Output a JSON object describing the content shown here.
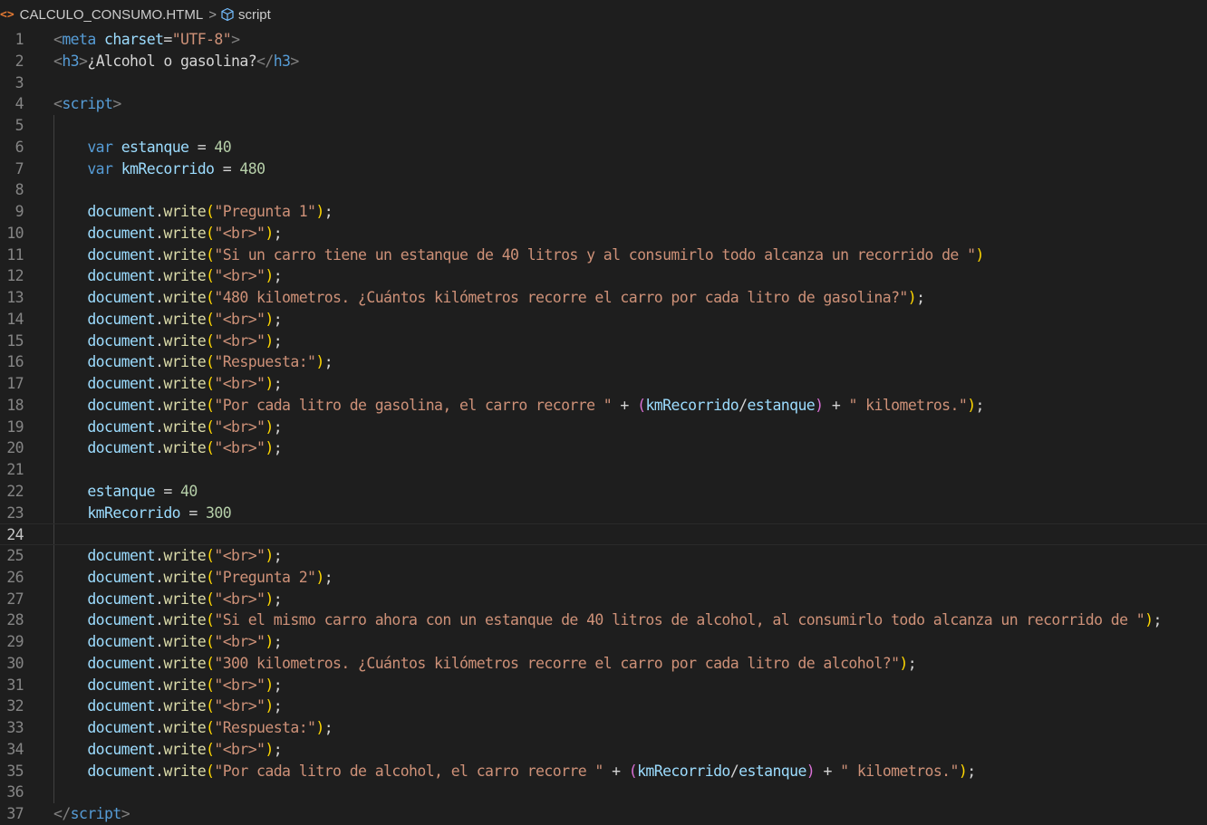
{
  "breadcrumb": {
    "file_icon": "<>",
    "file_name": "CALCULO_CONSUMO.HTML",
    "separator": ">",
    "symbol_icon": "cube-icon",
    "symbol": "script"
  },
  "editor": {
    "current_line": 24,
    "lines": [
      {
        "n": "1",
        "t": [
          [
            "  ",
            "p"
          ],
          [
            "<",
            "tag"
          ],
          [
            "meta",
            "tn"
          ],
          [
            " ",
            "p"
          ],
          [
            "charset",
            "attr"
          ],
          [
            "=",
            "p"
          ],
          [
            "\"UTF-8\"",
            "str"
          ],
          [
            ">",
            "tag"
          ]
        ]
      },
      {
        "n": "2",
        "t": [
          [
            "  ",
            "p"
          ],
          [
            "<",
            "tag"
          ],
          [
            "h3",
            "tn"
          ],
          [
            ">",
            "tag"
          ],
          [
            "¿Alcohol o gasolina?",
            "p"
          ],
          [
            "</",
            "tag"
          ],
          [
            "h3",
            "tn"
          ],
          [
            ">",
            "tag"
          ]
        ]
      },
      {
        "n": "3",
        "t": []
      },
      {
        "n": "4",
        "t": [
          [
            "  ",
            "p"
          ],
          [
            "<",
            "tag"
          ],
          [
            "script",
            "tn"
          ],
          [
            ">",
            "tag"
          ]
        ]
      },
      {
        "n": "5",
        "t": []
      },
      {
        "n": "6",
        "t": [
          [
            "      ",
            "p"
          ],
          [
            "var",
            "kw"
          ],
          [
            " ",
            "p"
          ],
          [
            "estanque",
            "var"
          ],
          [
            " = ",
            "p"
          ],
          [
            "40",
            "num"
          ]
        ]
      },
      {
        "n": "7",
        "t": [
          [
            "      ",
            "p"
          ],
          [
            "var",
            "kw"
          ],
          [
            " ",
            "p"
          ],
          [
            "kmRecorrido",
            "var"
          ],
          [
            " = ",
            "p"
          ],
          [
            "480",
            "num"
          ]
        ]
      },
      {
        "n": "8",
        "t": []
      },
      {
        "n": "9",
        "t": [
          [
            "      ",
            "p"
          ],
          [
            "document",
            "var"
          ],
          [
            ".",
            "p"
          ],
          [
            "write",
            "fn"
          ],
          [
            "(",
            "b1"
          ],
          [
            "\"Pregunta 1\"",
            "str"
          ],
          [
            ")",
            "b1"
          ],
          [
            ";",
            "p"
          ]
        ]
      },
      {
        "n": "10",
        "t": [
          [
            "      ",
            "p"
          ],
          [
            "document",
            "var"
          ],
          [
            ".",
            "p"
          ],
          [
            "write",
            "fn"
          ],
          [
            "(",
            "b1"
          ],
          [
            "\"<br>\"",
            "str"
          ],
          [
            ")",
            "b1"
          ],
          [
            ";",
            "p"
          ]
        ]
      },
      {
        "n": "11",
        "t": [
          [
            "      ",
            "p"
          ],
          [
            "document",
            "var"
          ],
          [
            ".",
            "p"
          ],
          [
            "write",
            "fn"
          ],
          [
            "(",
            "b1"
          ],
          [
            "\"Si un carro tiene un estanque de 40 litros y al consumirlo todo alcanza un recorrido de \"",
            "str"
          ],
          [
            ")",
            "b1"
          ]
        ]
      },
      {
        "n": "12",
        "t": [
          [
            "      ",
            "p"
          ],
          [
            "document",
            "var"
          ],
          [
            ".",
            "p"
          ],
          [
            "write",
            "fn"
          ],
          [
            "(",
            "b1"
          ],
          [
            "\"<br>\"",
            "str"
          ],
          [
            ")",
            "b1"
          ],
          [
            ";",
            "p"
          ]
        ]
      },
      {
        "n": "13",
        "t": [
          [
            "      ",
            "p"
          ],
          [
            "document",
            "var"
          ],
          [
            ".",
            "p"
          ],
          [
            "write",
            "fn"
          ],
          [
            "(",
            "b1"
          ],
          [
            "\"480 kilometros. ¿Cuántos kilómetros recorre el carro por cada litro de gasolina?\"",
            "str"
          ],
          [
            ")",
            "b1"
          ],
          [
            ";",
            "p"
          ]
        ]
      },
      {
        "n": "14",
        "t": [
          [
            "      ",
            "p"
          ],
          [
            "document",
            "var"
          ],
          [
            ".",
            "p"
          ],
          [
            "write",
            "fn"
          ],
          [
            "(",
            "b1"
          ],
          [
            "\"<br>\"",
            "str"
          ],
          [
            ")",
            "b1"
          ],
          [
            ";",
            "p"
          ]
        ]
      },
      {
        "n": "15",
        "t": [
          [
            "      ",
            "p"
          ],
          [
            "document",
            "var"
          ],
          [
            ".",
            "p"
          ],
          [
            "write",
            "fn"
          ],
          [
            "(",
            "b1"
          ],
          [
            "\"<br>\"",
            "str"
          ],
          [
            ")",
            "b1"
          ],
          [
            ";",
            "p"
          ]
        ]
      },
      {
        "n": "16",
        "t": [
          [
            "      ",
            "p"
          ],
          [
            "document",
            "var"
          ],
          [
            ".",
            "p"
          ],
          [
            "write",
            "fn"
          ],
          [
            "(",
            "b1"
          ],
          [
            "\"Respuesta:\"",
            "str"
          ],
          [
            ")",
            "b1"
          ],
          [
            ";",
            "p"
          ]
        ]
      },
      {
        "n": "17",
        "t": [
          [
            "      ",
            "p"
          ],
          [
            "document",
            "var"
          ],
          [
            ".",
            "p"
          ],
          [
            "write",
            "fn"
          ],
          [
            "(",
            "b1"
          ],
          [
            "\"<br>\"",
            "str"
          ],
          [
            ")",
            "b1"
          ],
          [
            ";",
            "p"
          ]
        ]
      },
      {
        "n": "18",
        "t": [
          [
            "      ",
            "p"
          ],
          [
            "document",
            "var"
          ],
          [
            ".",
            "p"
          ],
          [
            "write",
            "fn"
          ],
          [
            "(",
            "b1"
          ],
          [
            "\"Por cada litro de gasolina, el carro recorre \"",
            "str"
          ],
          [
            " + ",
            "p"
          ],
          [
            "(",
            "b2"
          ],
          [
            "kmRecorrido",
            "var"
          ],
          [
            "/",
            "p"
          ],
          [
            "estanque",
            "var"
          ],
          [
            ")",
            "b2"
          ],
          [
            " + ",
            "p"
          ],
          [
            "\" kilometros.\"",
            "str"
          ],
          [
            ")",
            "b1"
          ],
          [
            ";",
            "p"
          ]
        ]
      },
      {
        "n": "19",
        "t": [
          [
            "      ",
            "p"
          ],
          [
            "document",
            "var"
          ],
          [
            ".",
            "p"
          ],
          [
            "write",
            "fn"
          ],
          [
            "(",
            "b1"
          ],
          [
            "\"<br>\"",
            "str"
          ],
          [
            ")",
            "b1"
          ],
          [
            ";",
            "p"
          ]
        ]
      },
      {
        "n": "20",
        "t": [
          [
            "      ",
            "p"
          ],
          [
            "document",
            "var"
          ],
          [
            ".",
            "p"
          ],
          [
            "write",
            "fn"
          ],
          [
            "(",
            "b1"
          ],
          [
            "\"<br>\"",
            "str"
          ],
          [
            ")",
            "b1"
          ],
          [
            ";",
            "p"
          ]
        ]
      },
      {
        "n": "21",
        "t": []
      },
      {
        "n": "22",
        "t": [
          [
            "      ",
            "p"
          ],
          [
            "estanque",
            "var"
          ],
          [
            " = ",
            "p"
          ],
          [
            "40",
            "num"
          ]
        ]
      },
      {
        "n": "23",
        "t": [
          [
            "      ",
            "p"
          ],
          [
            "kmRecorrido",
            "var"
          ],
          [
            " = ",
            "p"
          ],
          [
            "300",
            "num"
          ]
        ]
      },
      {
        "n": "24",
        "t": []
      },
      {
        "n": "25",
        "t": [
          [
            "      ",
            "p"
          ],
          [
            "document",
            "var"
          ],
          [
            ".",
            "p"
          ],
          [
            "write",
            "fn"
          ],
          [
            "(",
            "b1"
          ],
          [
            "\"<br>\"",
            "str"
          ],
          [
            ")",
            "b1"
          ],
          [
            ";",
            "p"
          ]
        ]
      },
      {
        "n": "26",
        "t": [
          [
            "      ",
            "p"
          ],
          [
            "document",
            "var"
          ],
          [
            ".",
            "p"
          ],
          [
            "write",
            "fn"
          ],
          [
            "(",
            "b1"
          ],
          [
            "\"Pregunta 2\"",
            "str"
          ],
          [
            ")",
            "b1"
          ],
          [
            ";",
            "p"
          ]
        ]
      },
      {
        "n": "27",
        "t": [
          [
            "      ",
            "p"
          ],
          [
            "document",
            "var"
          ],
          [
            ".",
            "p"
          ],
          [
            "write",
            "fn"
          ],
          [
            "(",
            "b1"
          ],
          [
            "\"<br>\"",
            "str"
          ],
          [
            ")",
            "b1"
          ],
          [
            ";",
            "p"
          ]
        ]
      },
      {
        "n": "28",
        "t": [
          [
            "      ",
            "p"
          ],
          [
            "document",
            "var"
          ],
          [
            ".",
            "p"
          ],
          [
            "write",
            "fn"
          ],
          [
            "(",
            "b1"
          ],
          [
            "\"Si el mismo carro ahora con un estanque de 40 litros de alcohol, al consumirlo todo alcanza un recorrido de \"",
            "str"
          ],
          [
            ")",
            "b1"
          ],
          [
            ";",
            "p"
          ]
        ]
      },
      {
        "n": "29",
        "t": [
          [
            "      ",
            "p"
          ],
          [
            "document",
            "var"
          ],
          [
            ".",
            "p"
          ],
          [
            "write",
            "fn"
          ],
          [
            "(",
            "b1"
          ],
          [
            "\"<br>\"",
            "str"
          ],
          [
            ")",
            "b1"
          ],
          [
            ";",
            "p"
          ]
        ]
      },
      {
        "n": "30",
        "t": [
          [
            "      ",
            "p"
          ],
          [
            "document",
            "var"
          ],
          [
            ".",
            "p"
          ],
          [
            "write",
            "fn"
          ],
          [
            "(",
            "b1"
          ],
          [
            "\"300 kilometros. ¿Cuántos kilómetros recorre el carro por cada litro de alcohol?\"",
            "str"
          ],
          [
            ")",
            "b1"
          ],
          [
            ";",
            "p"
          ]
        ]
      },
      {
        "n": "31",
        "t": [
          [
            "      ",
            "p"
          ],
          [
            "document",
            "var"
          ],
          [
            ".",
            "p"
          ],
          [
            "write",
            "fn"
          ],
          [
            "(",
            "b1"
          ],
          [
            "\"<br>\"",
            "str"
          ],
          [
            ")",
            "b1"
          ],
          [
            ";",
            "p"
          ]
        ]
      },
      {
        "n": "32",
        "t": [
          [
            "      ",
            "p"
          ],
          [
            "document",
            "var"
          ],
          [
            ".",
            "p"
          ],
          [
            "write",
            "fn"
          ],
          [
            "(",
            "b1"
          ],
          [
            "\"<br>\"",
            "str"
          ],
          [
            ")",
            "b1"
          ],
          [
            ";",
            "p"
          ]
        ]
      },
      {
        "n": "33",
        "t": [
          [
            "      ",
            "p"
          ],
          [
            "document",
            "var"
          ],
          [
            ".",
            "p"
          ],
          [
            "write",
            "fn"
          ],
          [
            "(",
            "b1"
          ],
          [
            "\"Respuesta:\"",
            "str"
          ],
          [
            ")",
            "b1"
          ],
          [
            ";",
            "p"
          ]
        ]
      },
      {
        "n": "34",
        "t": [
          [
            "      ",
            "p"
          ],
          [
            "document",
            "var"
          ],
          [
            ".",
            "p"
          ],
          [
            "write",
            "fn"
          ],
          [
            "(",
            "b1"
          ],
          [
            "\"<br>\"",
            "str"
          ],
          [
            ")",
            "b1"
          ],
          [
            ";",
            "p"
          ]
        ]
      },
      {
        "n": "35",
        "t": [
          [
            "      ",
            "p"
          ],
          [
            "document",
            "var"
          ],
          [
            ".",
            "p"
          ],
          [
            "write",
            "fn"
          ],
          [
            "(",
            "b1"
          ],
          [
            "\"Por cada litro de alcohol, el carro recorre \"",
            "str"
          ],
          [
            " + ",
            "p"
          ],
          [
            "(",
            "b2"
          ],
          [
            "kmRecorrido",
            "var"
          ],
          [
            "/",
            "p"
          ],
          [
            "estanque",
            "var"
          ],
          [
            ")",
            "b2"
          ],
          [
            " + ",
            "p"
          ],
          [
            "\" kilometros.\"",
            "str"
          ],
          [
            ")",
            "b1"
          ],
          [
            ";",
            "p"
          ]
        ]
      },
      {
        "n": "36",
        "t": []
      },
      {
        "n": "37",
        "t": [
          [
            "  ",
            "p"
          ],
          [
            "</",
            "tag"
          ],
          [
            "script",
            "tn"
          ],
          [
            ">",
            "tag"
          ]
        ]
      }
    ]
  }
}
